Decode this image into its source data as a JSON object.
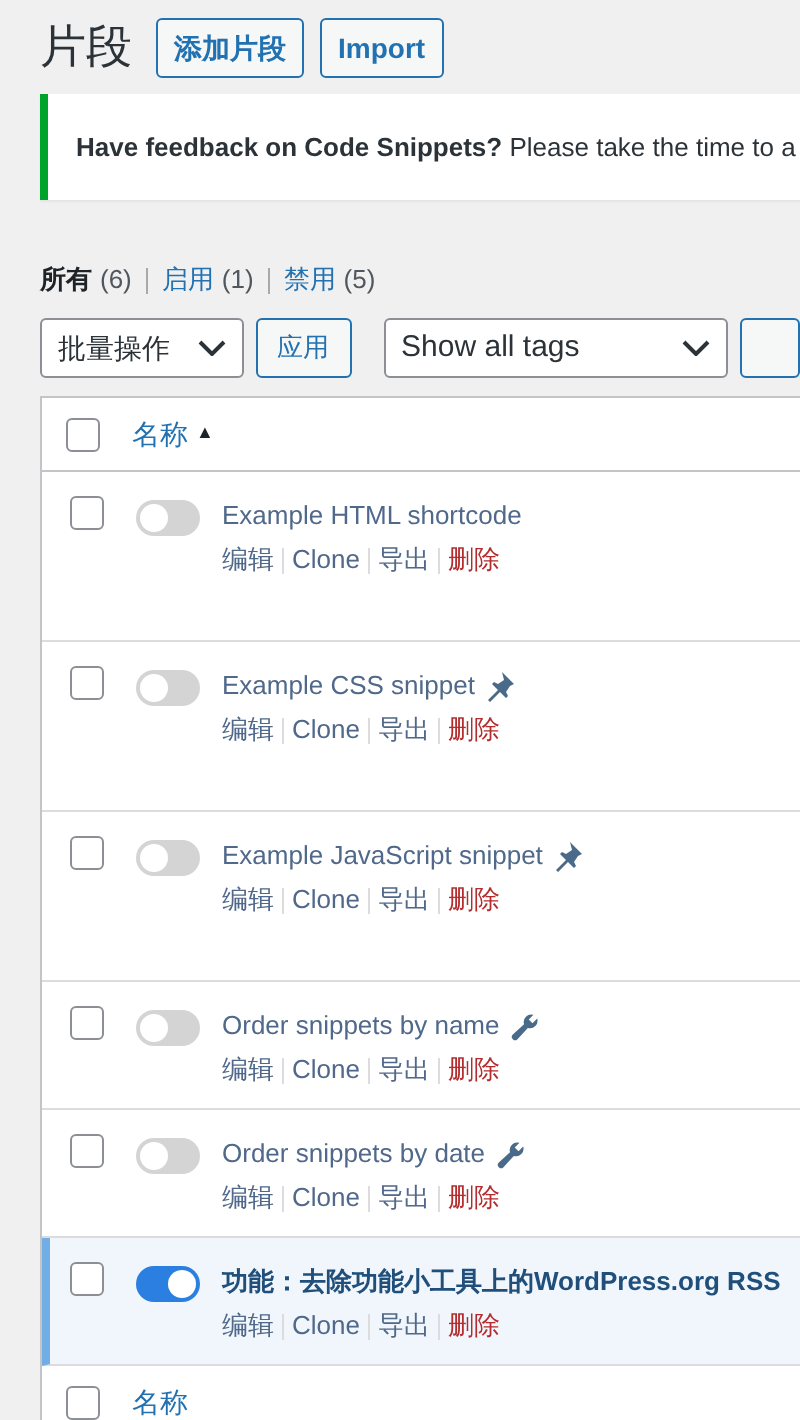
{
  "title": "片段",
  "header_buttons": [
    "添加片段",
    "Import"
  ],
  "notice": {
    "bold": "Have feedback on Code Snippets?",
    "text": "Please take the time to a"
  },
  "views": [
    {
      "label": "所有",
      "count": "(6)",
      "selected": true
    },
    {
      "label": "启用",
      "count": "(1)",
      "selected": false
    },
    {
      "label": "禁用",
      "count": "(5)",
      "selected": false
    }
  ],
  "bulk_select": "批量操作",
  "apply_button": "应用",
  "tag_select": "Show all tags",
  "table": {
    "column_header": "名称",
    "header_checked": false,
    "sort_arrow": "▲",
    "footer_header": "名称",
    "footer_checked": false,
    "rows": [
      {
        "name": "Example HTML shortcode",
        "checked": false,
        "active": false,
        "kind": "plain",
        "actions": [
          "编辑",
          "Clone",
          "导出",
          "删除"
        ]
      },
      {
        "name": "Example CSS snippet",
        "checked": false,
        "active": false,
        "kind": "pin",
        "actions": [
          "编辑",
          "Clone",
          "导出",
          "删除"
        ]
      },
      {
        "name": "Example JavaScript snippet",
        "checked": false,
        "active": false,
        "kind": "pin",
        "actions": [
          "编辑",
          "Clone",
          "导出",
          "删除"
        ]
      },
      {
        "name": "Order snippets by name",
        "checked": false,
        "active": false,
        "kind": "wrench",
        "actions": [
          "编辑",
          "Clone",
          "导出",
          "删除"
        ]
      },
      {
        "name": "Order snippets by date",
        "checked": false,
        "active": false,
        "kind": "wrench",
        "actions": [
          "编辑",
          "Clone",
          "导出",
          "删除"
        ]
      },
      {
        "name": "功能：去除功能小工具上的WordPress.org RSS",
        "checked": false,
        "active": true,
        "kind": "plain",
        "actions": [
          "编辑",
          "Clone",
          "导出",
          "删除"
        ]
      }
    ]
  }
}
